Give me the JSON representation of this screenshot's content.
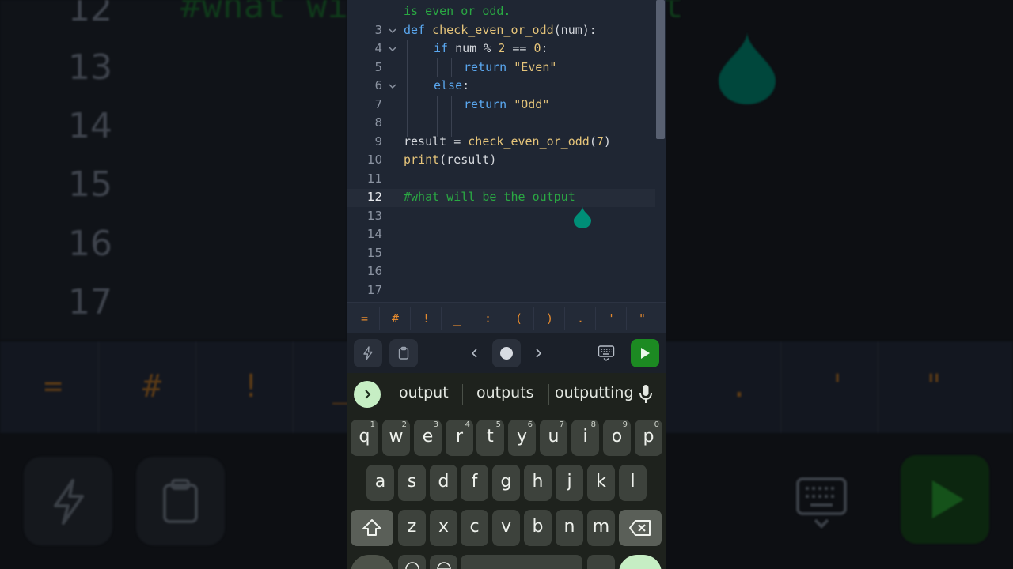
{
  "editor": {
    "line_numbers": [
      "3",
      "4",
      "5",
      "6",
      "7",
      "8",
      "9",
      "10",
      "11",
      "12",
      "13",
      "14",
      "15",
      "16",
      "17"
    ],
    "active_line": "12",
    "code": {
      "wrap": "is even or odd.",
      "l3_kw": "def",
      "l3_fn": "check_even_or_odd",
      "l3_rest": "(num):",
      "l4_kw": "if",
      "l4_a": " num % ",
      "l4_n1": "2",
      "l4_b": " == ",
      "l4_n2": "0",
      "l4_c": ":",
      "l5_kw": "return",
      "l5_str": "\"Even\"",
      "l6_kw": "else",
      "l6_c": ":",
      "l7_kw": "return",
      "l7_str": "\"Odd\"",
      "l9_a": "result = ",
      "l9_fn": "check_even_or_odd",
      "l9_b": "(",
      "l9_n": "7",
      "l9_c": ")",
      "l10_fn": "print",
      "l10_rest": "(result)",
      "l12_comment": "#what will be the ",
      "l12_word": "output"
    }
  },
  "symbols": [
    "=",
    "#",
    "!",
    "_",
    ":",
    "(",
    ")",
    ".",
    "'",
    "\""
  ],
  "toolbar": {
    "icons": [
      "lightning-icon",
      "clipboard-icon",
      "chevron-left-icon",
      "dot-icon",
      "chevron-right-icon",
      "keyboard-icon",
      "play-icon"
    ]
  },
  "keyboard": {
    "suggestions": [
      "output",
      "outputs",
      "outputting"
    ],
    "row1": [
      {
        "k": "q",
        "s": "1"
      },
      {
        "k": "w",
        "s": "2"
      },
      {
        "k": "e",
        "s": "3"
      },
      {
        "k": "r",
        "s": "4"
      },
      {
        "k": "t",
        "s": "5"
      },
      {
        "k": "y",
        "s": "6"
      },
      {
        "k": "u",
        "s": "7"
      },
      {
        "k": "i",
        "s": "8"
      },
      {
        "k": "o",
        "s": "9"
      },
      {
        "k": "p",
        "s": "0"
      }
    ],
    "row2": [
      "a",
      "s",
      "d",
      "f",
      "g",
      "h",
      "j",
      "k",
      "l"
    ],
    "row3": [
      "z",
      "x",
      "c",
      "v",
      "b",
      "n",
      "m"
    ]
  },
  "background": {
    "line_numbers": [
      "12",
      "13",
      "14",
      "15",
      "16",
      "17"
    ],
    "comment": "#what will be the output",
    "symbols": [
      "=",
      "#",
      "!",
      "_",
      ".",
      "'",
      "\""
    ]
  },
  "colors": {
    "accent_run": "#1c8a22",
    "keyword": "#5aa7ef",
    "function": "#e5c47a",
    "comment": "#2aa843",
    "symbol": "#e3892e",
    "cursor": "#008e77"
  }
}
